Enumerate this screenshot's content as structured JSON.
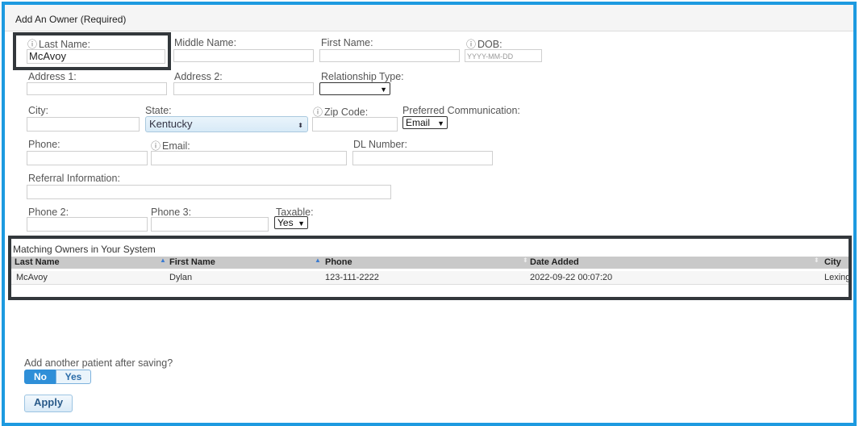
{
  "header": {
    "title": "Add An Owner (Required)"
  },
  "fields": {
    "last_name": {
      "label": "Last Name:",
      "value": "McAvoy"
    },
    "middle_name": {
      "label": "Middle Name:",
      "value": ""
    },
    "first_name": {
      "label": "First Name:",
      "value": ""
    },
    "dob": {
      "label": "DOB:",
      "placeholder": "YYYY-MM-DD"
    },
    "address1": {
      "label": "Address 1:"
    },
    "address2": {
      "label": "Address 2:"
    },
    "relationship_type": {
      "label": "Relationship Type:",
      "value": ""
    },
    "city": {
      "label": "City:"
    },
    "state": {
      "label": "State:",
      "value": "Kentucky"
    },
    "zip": {
      "label": "Zip Code:"
    },
    "preferred_comm": {
      "label": "Preferred Communication:",
      "value": "Email"
    },
    "phone": {
      "label": "Phone:"
    },
    "email": {
      "label": "Email:"
    },
    "dl_number": {
      "label": "DL Number:"
    },
    "referral": {
      "label": "Referral Information:"
    },
    "phone2": {
      "label": "Phone 2:"
    },
    "phone3": {
      "label": "Phone 3:"
    },
    "taxable": {
      "label": "Taxable:",
      "value": "Yes"
    }
  },
  "matching": {
    "title": "Matching Owners in Your System",
    "columns": [
      "Last Name",
      "First Name",
      "Phone",
      "Date Added",
      "City"
    ],
    "rows": [
      [
        "McAvoy",
        "Dylan",
        "123-111-2222",
        "2022-09-22 00:07:20",
        "Lexing"
      ]
    ]
  },
  "add_another": {
    "label": "Add another patient after saving?",
    "no": "No",
    "yes": "Yes",
    "selected": "No"
  },
  "apply_label": "Apply",
  "colors": {
    "border": "#1d9ae0",
    "callout": "#33383c",
    "toggle_active": "#2f8fd8"
  }
}
